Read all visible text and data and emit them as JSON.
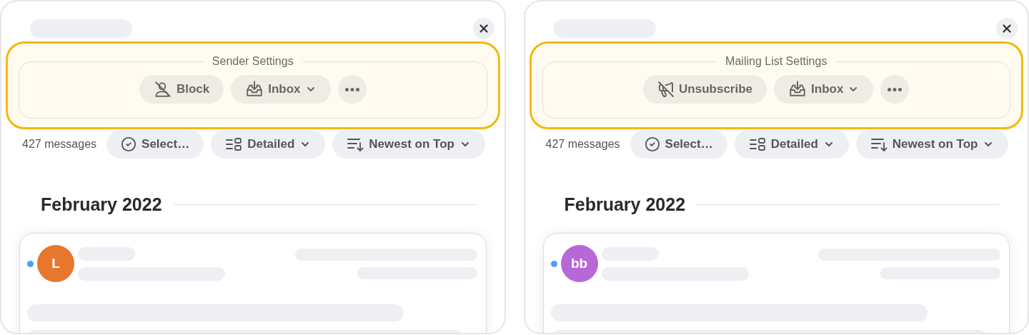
{
  "panels": [
    {
      "settings_title": "Sender Settings",
      "actions": [
        {
          "kind": "block",
          "label": "Block"
        },
        {
          "kind": "move",
          "label": "Inbox"
        },
        {
          "kind": "more"
        }
      ],
      "message_count": "427 messages",
      "toolbar": [
        {
          "kind": "select",
          "label": "Select…"
        },
        {
          "kind": "view",
          "label": "Detailed"
        },
        {
          "kind": "sort",
          "label": "Newest on Top"
        }
      ],
      "month": "February 2022",
      "message": {
        "avatar": "L",
        "color": "#e8772e",
        "unread": true
      }
    },
    {
      "settings_title": "Mailing List Settings",
      "actions": [
        {
          "kind": "unsubscribe",
          "label": "Unsubscribe"
        },
        {
          "kind": "move",
          "label": "Inbox"
        },
        {
          "kind": "more"
        }
      ],
      "message_count": "427 messages",
      "toolbar": [
        {
          "kind": "select",
          "label": "Select…"
        },
        {
          "kind": "view",
          "label": "Detailed"
        },
        {
          "kind": "sort",
          "label": "Newest on Top"
        }
      ],
      "month": "February 2022",
      "message": {
        "avatar": "bb",
        "color": "#b867d6",
        "unread": true
      }
    }
  ]
}
